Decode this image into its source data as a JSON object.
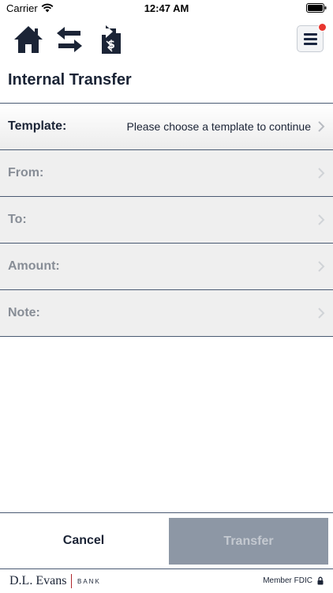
{
  "status_bar": {
    "carrier": "Carrier",
    "time": "12:47 AM"
  },
  "toolbar": {
    "icons": [
      "home-icon",
      "transfer-arrows-icon",
      "bill-pay-icon",
      "menu-icon"
    ],
    "has_notification": true
  },
  "page": {
    "title": "Internal Transfer"
  },
  "form": {
    "rows": [
      {
        "label": "Template:",
        "value": "Please choose a template to continue"
      },
      {
        "label": "From:",
        "value": ""
      },
      {
        "label": "To:",
        "value": ""
      },
      {
        "label": "Amount:",
        "value": ""
      },
      {
        "label": "Note:",
        "value": ""
      }
    ]
  },
  "actions": {
    "cancel_label": "Cancel",
    "transfer_label": "Transfer"
  },
  "footer": {
    "logo_name": "D.L. Evans",
    "logo_bank": "BANK",
    "fdic": "Member FDIC"
  },
  "colors": {
    "brand_navy": "#1b2436",
    "disabled_button": "#8d97a5",
    "notification": "#e8362f",
    "logo_accent": "#b0282c"
  }
}
